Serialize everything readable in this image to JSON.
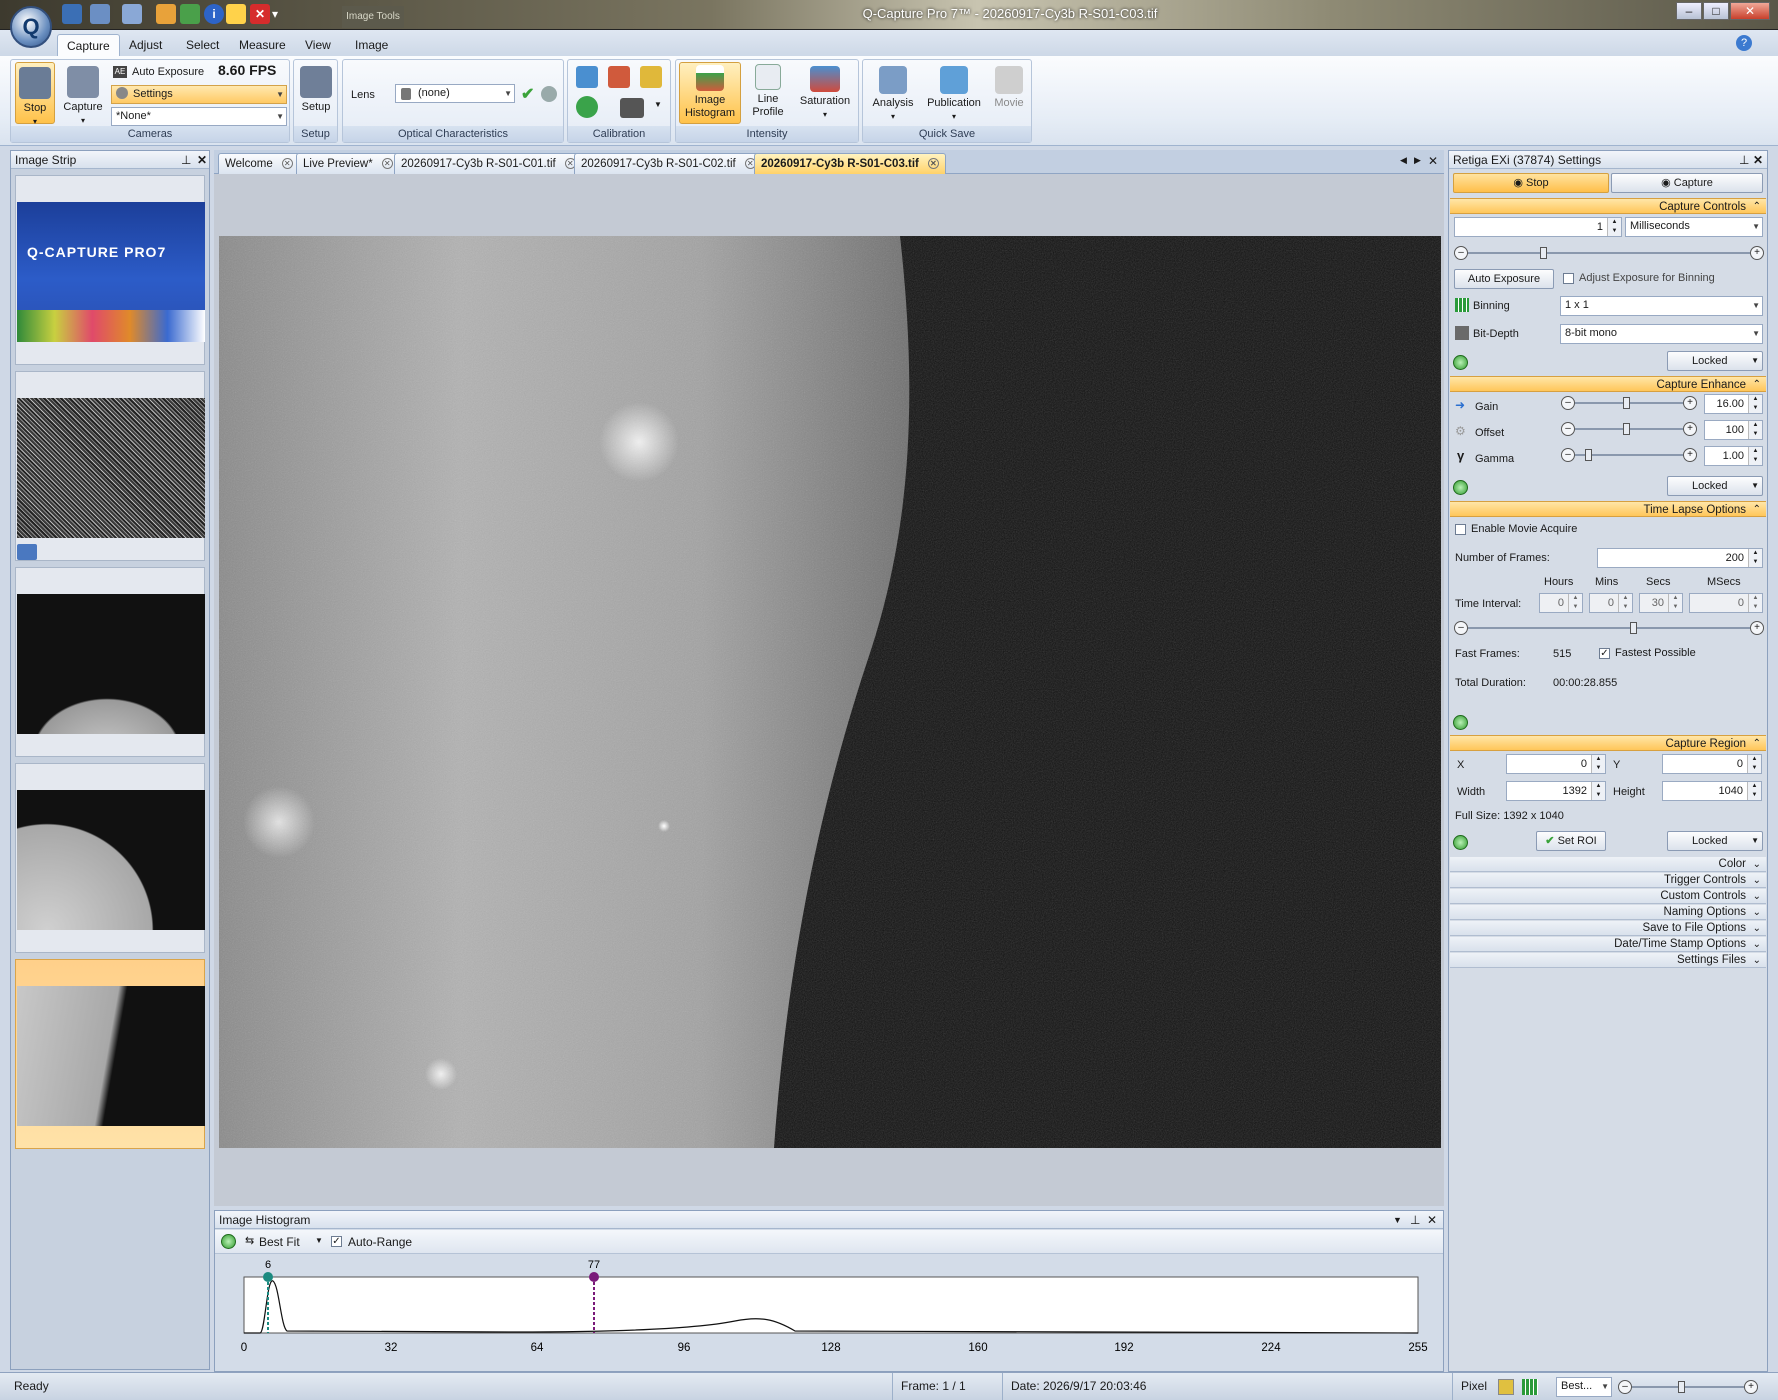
{
  "window": {
    "title": "Q-Capture Pro 7™ - 20260917-Cy3b R-S01-C03.tif",
    "context_tab": "Image Tools",
    "controls": [
      "minimize",
      "maximize",
      "close"
    ]
  },
  "ribbon_tabs": [
    "Capture",
    "Adjust",
    "Select",
    "Measure",
    "View",
    "Image"
  ],
  "ribbon": {
    "cameras": {
      "label": "Cameras",
      "stop": "Stop",
      "capture": "Capture",
      "auto_exposure": "Auto Exposure",
      "fps": "8.60 FPS",
      "settings": "Settings",
      "preset": "*None*"
    },
    "setup": {
      "label": "Setup",
      "button": "Setup"
    },
    "optical": {
      "label": "Optical Characteristics",
      "lens_label": "Lens",
      "lens_value": "(none)"
    },
    "calibration": {
      "label": "Calibration"
    },
    "intensity": {
      "label": "Intensity",
      "image_histogram": "Image Histogram",
      "line_profile": "Line Profile",
      "saturation": "Saturation"
    },
    "quick_save": {
      "label": "Quick Save",
      "analysis": "Analysis",
      "publication": "Publication",
      "movie": "Movie"
    }
  },
  "image_strip": {
    "title": "Image Strip"
  },
  "doc_tabs": [
    "Welcome",
    "Live Preview*",
    "20260917-Cy3b R-S01-C01.tif",
    "20260917-Cy3b R-S01-C02.tif",
    "20260917-Cy3b R-S01-C03.tif"
  ],
  "splash": {
    "logo": "Q-CAPTURE PRO7"
  },
  "histogram": {
    "title": "Image Histogram",
    "fit": "Best Fit",
    "auto_range": "Auto-Range",
    "low_marker": "6",
    "high_marker": "77",
    "ticks": [
      "0",
      "32",
      "64",
      "96",
      "128",
      "160",
      "192",
      "224",
      "255"
    ]
  },
  "settings": {
    "title": "Retiga EXi (37874) Settings",
    "stop": "Stop",
    "capture": "Capture",
    "capture_controls": {
      "header": "Capture Controls",
      "exposure_value": "1",
      "exposure_unit": "Milliseconds",
      "auto_exposure": "Auto Exposure",
      "adjust_binning": "Adjust Exposure for Binning",
      "binning_label": "Binning",
      "binning_value": "1 x 1",
      "bitdepth_label": "Bit-Depth",
      "bitdepth_value": "8-bit mono",
      "locked": "Locked"
    },
    "capture_enhance": {
      "header": "Capture Enhance",
      "gain_label": "Gain",
      "gain_value": "16.00",
      "offset_label": "Offset",
      "offset_value": "100",
      "gamma_label": "Gamma",
      "gamma_value": "1.00",
      "locked": "Locked"
    },
    "time_lapse": {
      "header": "Time Lapse Options",
      "enable_movie": "Enable Movie Acquire",
      "frames_label": "Number of  Frames:",
      "frames_value": "200",
      "col_hours": "Hours",
      "col_mins": "Mins",
      "col_secs": "Secs",
      "col_msecs": "MSecs",
      "interval_label": "Time Interval:",
      "hours": "0",
      "mins": "0",
      "secs": "30",
      "msecs": "0",
      "fast_frames_label": "Fast Frames:",
      "fast_frames_value": "515",
      "fastest_possible": "Fastest Possible",
      "total_duration_label": "Total Duration:",
      "total_duration_value": "00:00:28.855"
    },
    "capture_region": {
      "header": "Capture Region",
      "x_label": "X",
      "x_value": "0",
      "y_label": "Y",
      "y_value": "0",
      "width_label": "Width",
      "width_value": "1392",
      "height_label": "Height",
      "height_value": "1040",
      "full_size": "Full Size: 1392 x 1040",
      "set_roi": "Set ROI",
      "locked": "Locked"
    },
    "collapsed": [
      "Color",
      "Trigger Controls",
      "Custom Controls",
      "Naming Options",
      "Save to File Options",
      "Date/Time Stamp Options",
      "Settings Files"
    ]
  },
  "status": {
    "ready": "Ready",
    "frame": "Frame: 1 / 1",
    "date": "Date: 2026/9/17 20:03:46",
    "pixel": "Pixel",
    "zoom": "Best..."
  }
}
